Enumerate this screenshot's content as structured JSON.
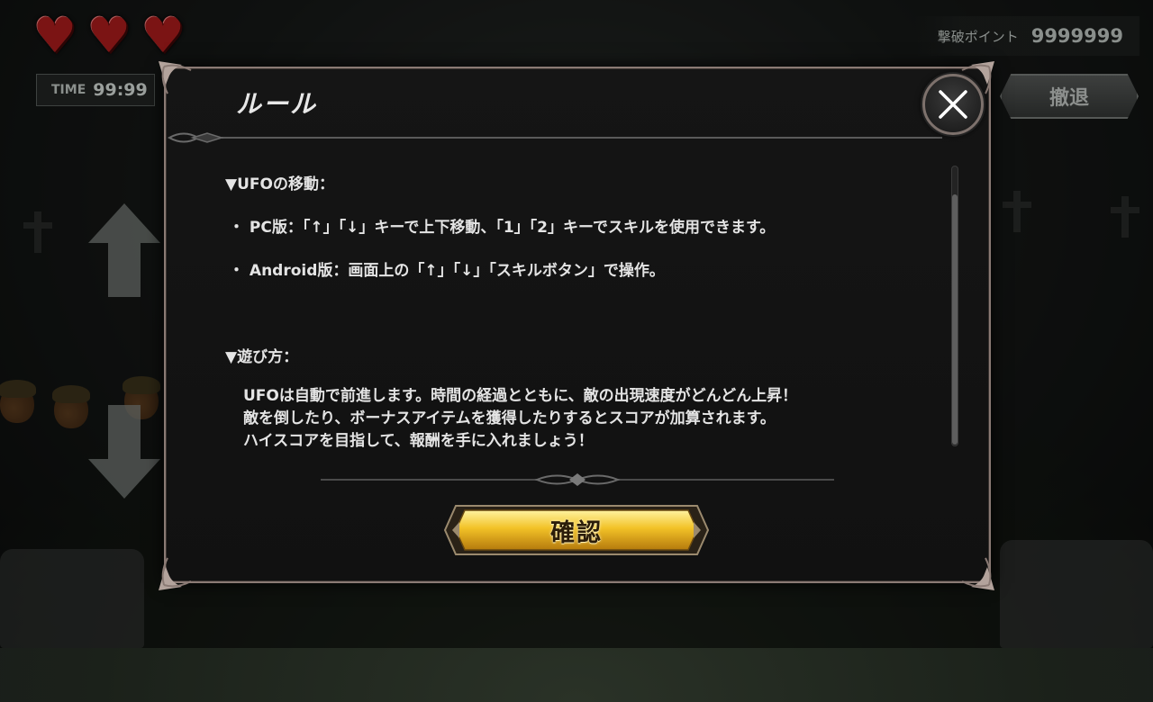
{
  "hud": {
    "lives": 3,
    "heart_glyph": "♥",
    "time_label": "TIME",
    "time_value": "99:99",
    "score_label": "撃破ポイント",
    "score_value": "9999999",
    "retreat_label": "撤退"
  },
  "dialog": {
    "title": "ルール",
    "sections": [
      {
        "heading": "▼UFOの移動：",
        "items": [
          "・ PC版：「↑」「↓」キーで上下移動、「1」「2」キーでスキルを使用できます。",
          "・ Android版：画面上の「↑」「↓」「スキルボタン」で操作。"
        ]
      },
      {
        "heading": "▼遊び方：",
        "paragraph": [
          "UFOは自動で前進します。時間の経過とともに、敵の出現速度がどんどん上昇！",
          "敵を倒したり、ボーナスアイテムを獲得したりするとスコアが加算されます。",
          "ハイスコアを目指して、報酬を手に入れましょう！"
        ]
      }
    ],
    "confirm_label": "確認",
    "scroll_position": 0.1
  },
  "colors": {
    "dialog_border": "#8a7a74",
    "confirm_gold": "#f2c227",
    "heart_red": "#7b1414"
  }
}
